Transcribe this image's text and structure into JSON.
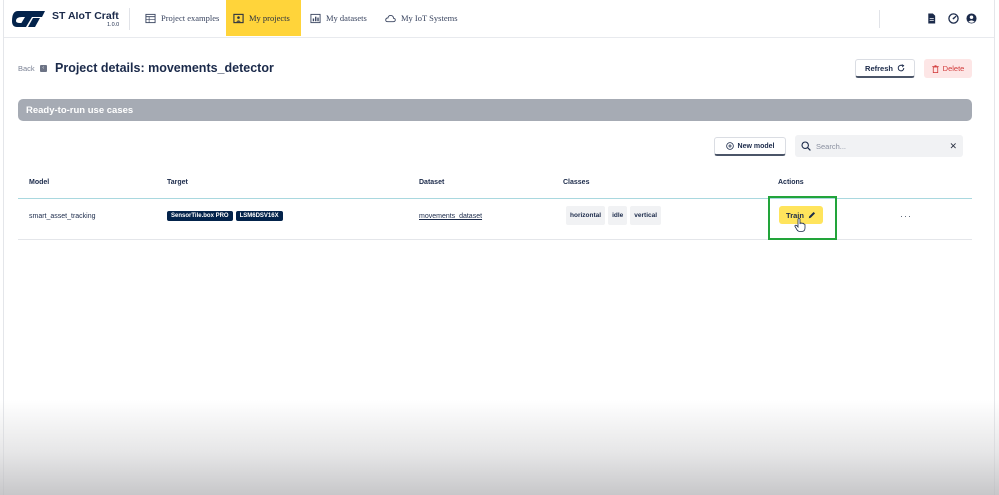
{
  "brand": {
    "name": "ST AIoT Craft",
    "version": "1.0.0"
  },
  "nav": {
    "items": [
      {
        "label": "Project examples",
        "icon": "grid-calendar-icon",
        "active": false
      },
      {
        "label": "My projects",
        "icon": "folder-person-icon",
        "active": true
      },
      {
        "label": "My datasets",
        "icon": "bar-chart-icon",
        "active": false
      },
      {
        "label": "My IoT Systems",
        "icon": "cloud-icon",
        "active": false
      }
    ],
    "right_icons": [
      "document-icon",
      "gauge-icon",
      "account-icon"
    ]
  },
  "header": {
    "back_label": "Back",
    "title": "Project details: movements_detector",
    "refresh_label": "Refresh",
    "delete_label": "Delete"
  },
  "section": {
    "title": "Ready-to-run use cases"
  },
  "toolbar": {
    "new_model_label": "New model",
    "search_placeholder": "Search..."
  },
  "table": {
    "columns": [
      "Model",
      "Target",
      "Dataset",
      "Classes",
      "Actions"
    ],
    "rows": [
      {
        "model": "smart_asset_tracking",
        "targets": [
          "SensorTile.box PRO",
          "LSM6DSV16X"
        ],
        "dataset": "movements_dataset",
        "classes": [
          "horizontal",
          "idle",
          "vertical"
        ],
        "action_label": "Train",
        "more_label": "···"
      }
    ]
  },
  "colors": {
    "accent_yellow": "#ffd43a",
    "train_yellow": "#ffe45c",
    "chip_navy": "#03234b",
    "highlight_green": "#22a43a",
    "delete_red": "#d23b3b"
  }
}
